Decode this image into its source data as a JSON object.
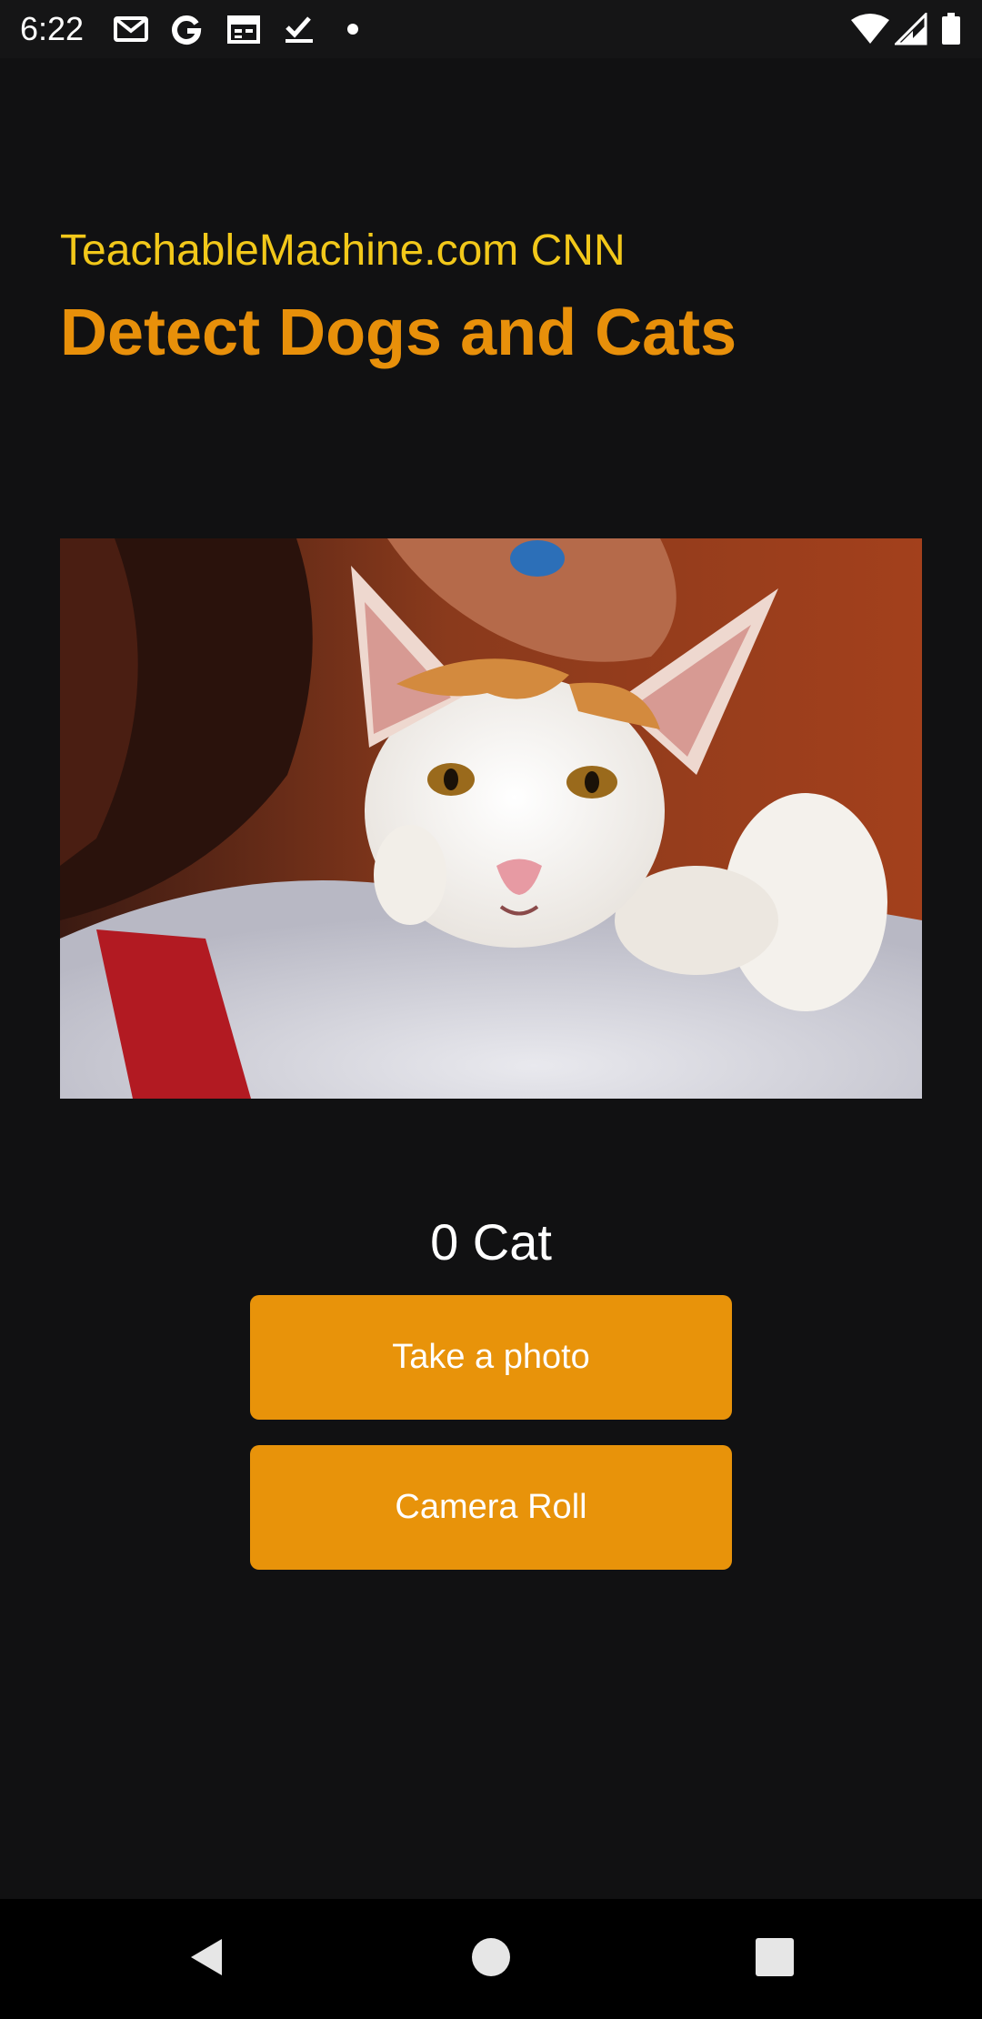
{
  "status_bar": {
    "time": "6:22",
    "left_icons": [
      "gmail-icon",
      "google-icon",
      "calendar-icon",
      "tasks-check-icon",
      "notification-dot-icon"
    ],
    "right_icons": [
      "wifi-icon",
      "cellular-signal-icon",
      "battery-icon"
    ]
  },
  "header": {
    "subtitle": "TeachableMachine.com CNN",
    "title": "Detect Dogs and Cats"
  },
  "photo": {
    "subject": "cat-photo"
  },
  "prediction": {
    "text": "0 Cat"
  },
  "buttons": {
    "take_photo": "Take a photo",
    "camera_roll": "Camera Roll"
  },
  "nav": {
    "items": [
      "back-icon",
      "home-icon",
      "recents-icon"
    ]
  },
  "colors": {
    "background": "#111112",
    "subtitle": "#f2c81a",
    "title": "#e8900a",
    "button": "#e8930a",
    "button_text": "#ffffff"
  }
}
